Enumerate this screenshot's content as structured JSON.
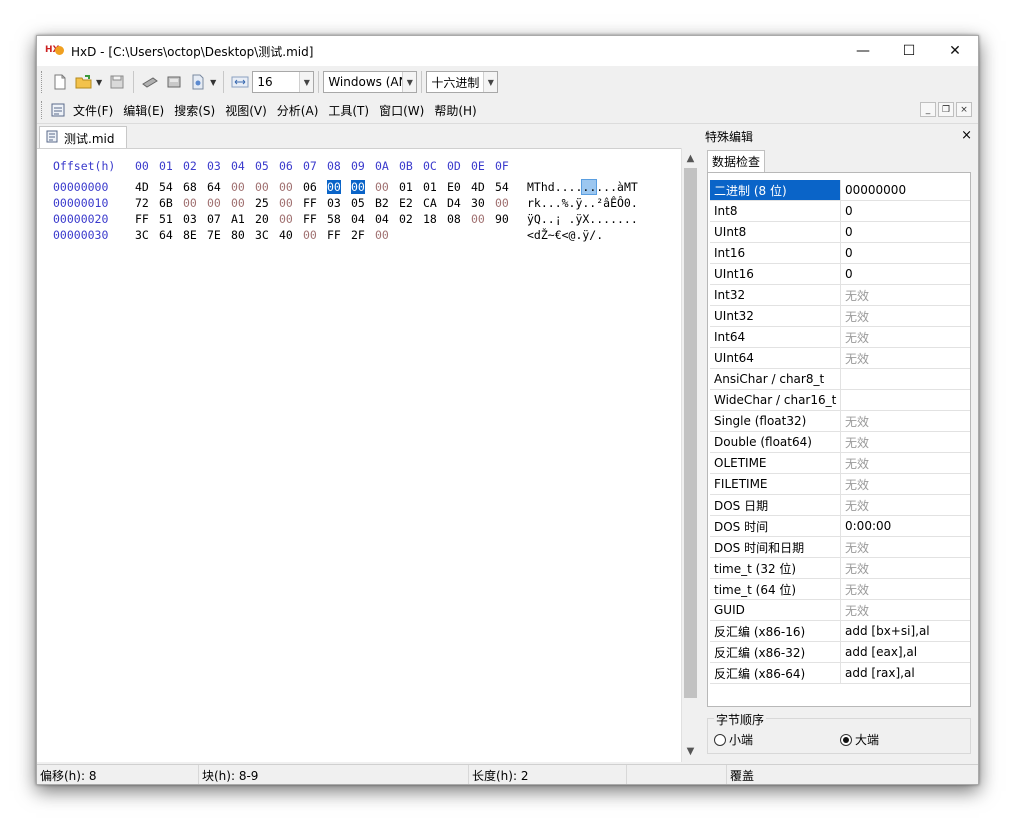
{
  "window": {
    "title": "HxD - [C:\\Users\\octop\\Desktop\\测试.mid]",
    "minimize": "—",
    "maximize": "☐",
    "close": "✕"
  },
  "toolbar": {
    "bytes_per_row": "16",
    "charset": "Windows (AN",
    "display_mode": "十六进制"
  },
  "menu": [
    "文件(F)",
    "编辑(E)",
    "搜索(S)",
    "视图(V)",
    "分析(A)",
    "工具(T)",
    "窗口(W)",
    "帮助(H)"
  ],
  "document_tab": "测试.mid",
  "hex": {
    "header_label": "Offset(h)",
    "header_cols": [
      "00",
      "01",
      "02",
      "03",
      "04",
      "05",
      "06",
      "07",
      "08",
      "09",
      "0A",
      "0B",
      "0C",
      "0D",
      "0E",
      "0F"
    ],
    "rows": [
      {
        "offset": "00000000",
        "bytes": [
          "4D",
          "54",
          "68",
          "64",
          "00",
          "00",
          "00",
          "06",
          "00",
          "00",
          "00",
          "01",
          "01",
          "E0",
          "4D",
          "54"
        ],
        "ascii_pre": "MThd....",
        "ascii_sel": "..",
        "ascii_post": "...àMT"
      },
      {
        "offset": "00000010",
        "bytes": [
          "72",
          "6B",
          "00",
          "00",
          "00",
          "25",
          "00",
          "FF",
          "03",
          "05",
          "B2",
          "E2",
          "CA",
          "D4",
          "30",
          "00"
        ],
        "ascii_pre": "rk...%.ÿ..²âÊÔ0.",
        "ascii_sel": "",
        "ascii_post": ""
      },
      {
        "offset": "00000020",
        "bytes": [
          "FF",
          "51",
          "03",
          "07",
          "A1",
          "20",
          "00",
          "FF",
          "58",
          "04",
          "04",
          "02",
          "18",
          "08",
          "00",
          "90"
        ],
        "ascii_pre": "ÿQ..¡ .ÿX.......",
        "ascii_sel": "",
        "ascii_post": ""
      },
      {
        "offset": "00000030",
        "bytes": [
          "3C",
          "64",
          "8E",
          "7E",
          "80",
          "3C",
          "40",
          "00",
          "FF",
          "2F",
          "00"
        ],
        "ascii_pre": "<dŽ~€<@.ÿ/.",
        "ascii_sel": "",
        "ascii_post": ""
      }
    ],
    "selected_offsets": [
      8,
      9
    ]
  },
  "side_panel": {
    "title": "特殊编辑",
    "close": "×",
    "tab": "数据检查",
    "rows": [
      {
        "k": "二进制 (8 位)",
        "v": "00000000"
      },
      {
        "k": "Int8",
        "v": "0"
      },
      {
        "k": "UInt8",
        "v": "0"
      },
      {
        "k": "Int16",
        "v": "0"
      },
      {
        "k": "UInt16",
        "v": "0"
      },
      {
        "k": "Int32",
        "v": "无效"
      },
      {
        "k": "UInt32",
        "v": "无效"
      },
      {
        "k": "Int64",
        "v": "无效"
      },
      {
        "k": "UInt64",
        "v": "无效"
      },
      {
        "k": "AnsiChar / char8_t",
        "v": ""
      },
      {
        "k": "WideChar / char16_t",
        "v": ""
      },
      {
        "k": "Single (float32)",
        "v": "无效"
      },
      {
        "k": "Double (float64)",
        "v": "无效"
      },
      {
        "k": "OLETIME",
        "v": "无效"
      },
      {
        "k": "FILETIME",
        "v": "无效"
      },
      {
        "k": "DOS 日期",
        "v": "无效"
      },
      {
        "k": "DOS 时间",
        "v": "0:00:00"
      },
      {
        "k": "DOS 时间和日期",
        "v": "无效"
      },
      {
        "k": "time_t (32 位)",
        "v": "无效"
      },
      {
        "k": "time_t (64 位)",
        "v": "无效"
      },
      {
        "k": "GUID",
        "v": "无效"
      },
      {
        "k": "反汇编 (x86-16)",
        "v": "add [bx+si],al"
      },
      {
        "k": "反汇编 (x86-32)",
        "v": "add [eax],al"
      },
      {
        "k": "反汇编 (x86-64)",
        "v": "add [rax],al"
      }
    ],
    "byte_order": {
      "legend": "字节顺序",
      "little": "小端",
      "big": "大端",
      "selected": "big"
    }
  },
  "status": {
    "offset": "偏移(h): 8",
    "block": "块(h): 8-9",
    "length": "长度(h): 2",
    "mode": "覆盖"
  }
}
